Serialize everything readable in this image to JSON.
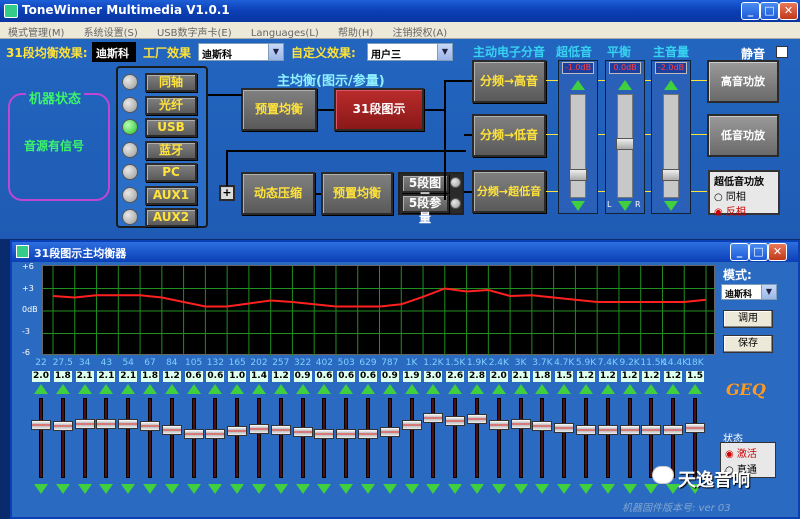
{
  "window": {
    "title": "ToneWinner Multimedia V1.0.1"
  },
  "menu": [
    "模式管理(M)",
    "系统设置(S)",
    "USB数字声卡(E)",
    "Languages(L)",
    "帮助(H)",
    "注销授权(A)"
  ],
  "top": {
    "eq31_label": "31段均衡效果:",
    "eq31_value": "迪斯科",
    "factory_label": "工厂效果",
    "factory_value": "迪斯科",
    "custom_label": "自定义效果:",
    "custom_value": "用户三",
    "crossover_label": "主动电子分音",
    "subwoofer_label": "超低音",
    "balance_label": "平衡",
    "master_label": "主音量",
    "mute_label": "静音"
  },
  "status": {
    "title": "机器状态",
    "signal": "音源有信号"
  },
  "sources": [
    {
      "label": "同轴",
      "active": false
    },
    {
      "label": "光纤",
      "active": false
    },
    {
      "label": "USB",
      "active": true
    },
    {
      "label": "蓝牙",
      "active": false
    },
    {
      "label": "PC",
      "active": false
    },
    {
      "label": "AUX1",
      "active": false
    },
    {
      "label": "AUX2",
      "active": false
    }
  ],
  "chain": {
    "main_eq_title": "主均衡(图示/参量)",
    "preset_eq": "预置均衡",
    "graphic31": "31段图示",
    "dynamic": "动态压缩",
    "preset_eq2": "预置均衡",
    "eq5_graphic": "5段图示",
    "eq5_param": "5段参量",
    "cross_high": "分频→高音",
    "cross_low": "分频→低音",
    "cross_sub": "分频→超低音",
    "amp_high": "高音功放",
    "amp_low": "低音功放",
    "plus": "+"
  },
  "sliders": {
    "sub": {
      "readout": "-1.0dB",
      "level": 0.2
    },
    "balance": {
      "readout": "0.0dB",
      "level": 0.5,
      "left": "L",
      "right": "R"
    },
    "master": {
      "readout": "-2.0dB",
      "level": 0.2
    }
  },
  "subamp": {
    "title": "超低音功放",
    "options": [
      "同相",
      "反相"
    ],
    "selected": 1
  },
  "eq": {
    "title": "31段图示主均衡器",
    "y_ticks": [
      "+6",
      "+3",
      "0dB",
      "-3",
      "-6"
    ],
    "freqs": [
      "22",
      "27.5",
      "34",
      "43",
      "54",
      "67",
      "84",
      "105",
      "132",
      "165",
      "202",
      "257",
      "322",
      "402",
      "503",
      "629",
      "787",
      "1K",
      "1.2K",
      "1.5K",
      "1.9K",
      "2.4K",
      "3K",
      "3.7K",
      "4.7K",
      "5.9K",
      "7.4K",
      "9.2K",
      "11.5K",
      "14.4K",
      "18K"
    ],
    "gains": [
      "2.0",
      "1.8",
      "2.1",
      "2.1",
      "2.1",
      "1.8",
      "1.2",
      "0.6",
      "0.6",
      "1.0",
      "1.4",
      "1.2",
      "0.9",
      "0.6",
      "0.6",
      "0.6",
      "0.9",
      "1.9",
      "3.0",
      "2.6",
      "2.8",
      "2.0",
      "2.1",
      "1.8",
      "1.5",
      "1.2",
      "1.2",
      "1.2",
      "1.2",
      "1.2",
      "1.5"
    ],
    "mode_label": "模式:",
    "mode_value": "迪斯科",
    "adjust_button": "调用",
    "save_button": "保存",
    "geq_logo": "GEQ",
    "state_label": "状态",
    "state_active": "激活",
    "state_off": "直通",
    "footer": "机器固件版本号: ver 03",
    "watermark": "天逸音响"
  },
  "colors": {
    "curve": "#ff2020",
    "grid": "#1f8f1f"
  }
}
